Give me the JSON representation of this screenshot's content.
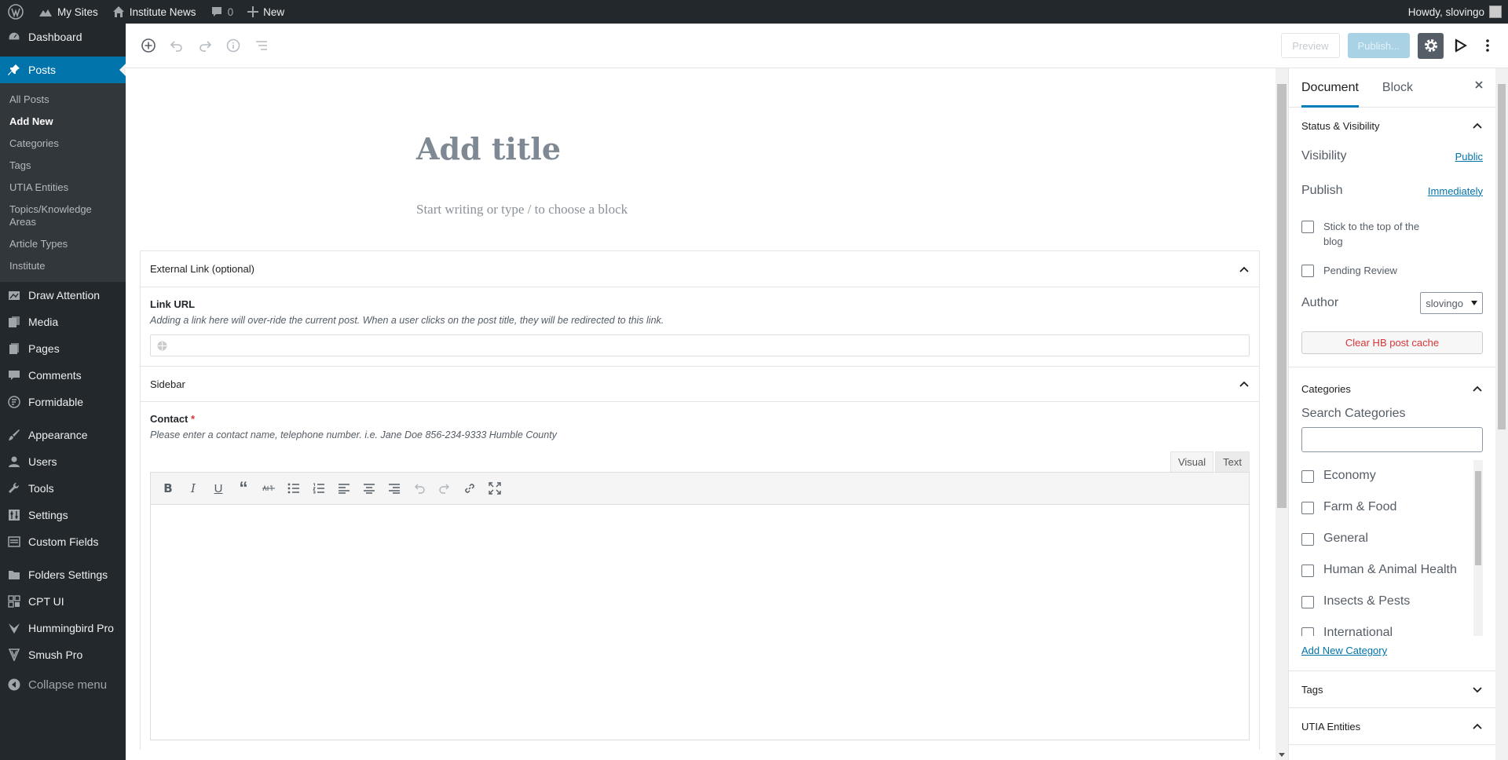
{
  "adminbar": {
    "my_sites": "My Sites",
    "site_name": "Institute News",
    "comments_count": "0",
    "new_label": "New",
    "howdy": "Howdy, slovingo"
  },
  "sidebar": {
    "dashboard": "Dashboard",
    "posts": "Posts",
    "posts_sub": [
      "All Posts",
      "Add New",
      "Categories",
      "Tags",
      "UTIA Entities",
      "Topics/Knowledge Areas",
      "Article Types",
      "Institute"
    ],
    "items": [
      "Draw Attention",
      "Media",
      "Pages",
      "Comments",
      "Formidable",
      "Appearance",
      "Users",
      "Tools",
      "Settings",
      "Custom Fields",
      "Folders Settings",
      "CPT UI",
      "Hummingbird Pro",
      "Smush Pro"
    ],
    "collapse": "Collapse menu"
  },
  "toolbar": {
    "preview": "Preview",
    "publish": "Publish..."
  },
  "editor": {
    "title_placeholder": "Add title",
    "body_placeholder": "Start writing or type / to choose a block"
  },
  "metaboxes": {
    "external_link_title": "External Link (optional)",
    "link_url_label": "Link URL",
    "link_url_desc": "Adding a link here will over-ride the current post. When a user clicks on the post title, they will be redirected to this link.",
    "sidebar_title": "Sidebar",
    "contact_label": "Contact",
    "contact_required": "*",
    "contact_desc": "Please enter a contact name, telephone number. i.e. Jane Doe 856-234-9333 Humble County",
    "tab_visual": "Visual",
    "tab_text": "Text"
  },
  "settings": {
    "tab_document": "Document",
    "tab_block": "Block",
    "status_title": "Status & Visibility",
    "visibility_label": "Visibility",
    "visibility_value": "Public",
    "publish_label": "Publish",
    "publish_value": "Immediately",
    "sticky_label": "Stick to the top of the blog",
    "pending_label": "Pending Review",
    "author_label": "Author",
    "author_value": "slovingo",
    "clear_cache": "Clear HB post cache",
    "categories_title": "Categories",
    "search_categories": "Search Categories",
    "categories": [
      "Economy",
      "Farm & Food",
      "General",
      "Human & Animal Health",
      "Insects & Pests",
      "International"
    ],
    "add_new_category": "Add New Category",
    "tags_title": "Tags",
    "utia_title": "UTIA Entities"
  }
}
